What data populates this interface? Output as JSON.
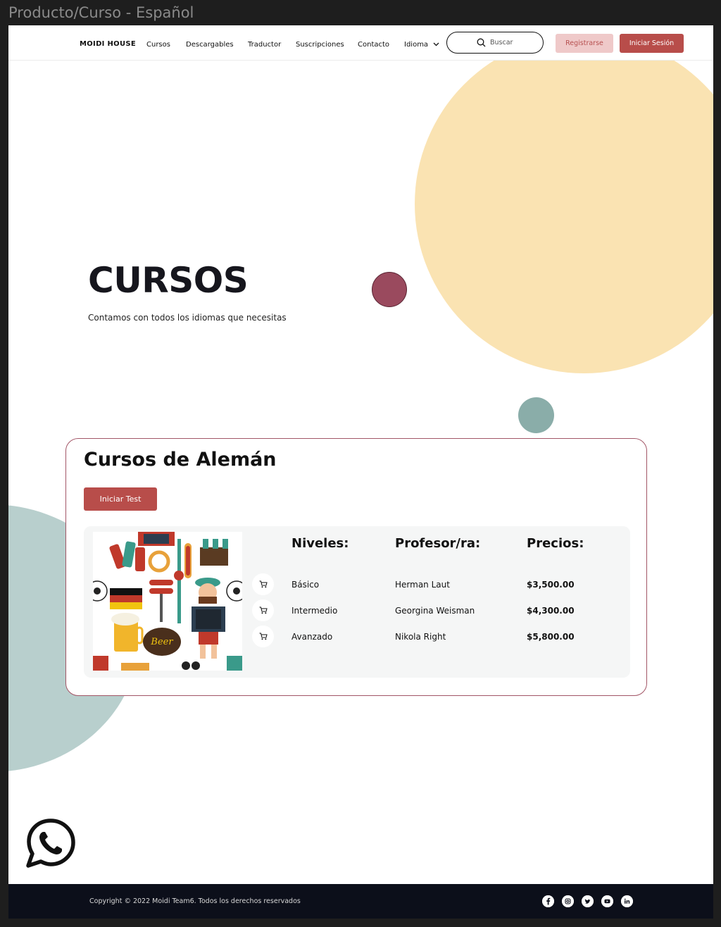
{
  "frame": {
    "title": "Producto/Curso - Español"
  },
  "navbar": {
    "brand": "MOIDI HOUSE",
    "links": [
      "Cursos",
      "Descargables",
      "Traductor",
      "Suscripciones",
      "Contacto",
      "Idioma"
    ],
    "search_placeholder": "Buscar",
    "register_label": "Registrarse",
    "login_label": "Iniciar Sesión"
  },
  "hero": {
    "title": "CURSOS",
    "subtitle": "Contamos con todos los idiomas que necesitas"
  },
  "course": {
    "title": "Cursos de Alemán",
    "test_button": "Iniciar Test",
    "image_text": "Beer",
    "headers": {
      "levels": "Niveles:",
      "teacher": "Profesor/ra:",
      "prices": "Precios:"
    },
    "rows": [
      {
        "level": "Básico",
        "teacher": "Herman Laut",
        "price": "$3,500.00"
      },
      {
        "level": "Intermedio",
        "teacher": "Georgina Weisman",
        "price": "$4,300.00"
      },
      {
        "level": "Avanzado",
        "teacher": "Nikola Right",
        "price": "$5,800.00"
      }
    ]
  },
  "footer": {
    "copyright": "Copyright © 2022 Moidi Team6. Todos los derechos reservados",
    "social": [
      "facebook-icon",
      "instagram-icon",
      "twitter-icon",
      "youtube-icon",
      "linkedin-icon"
    ]
  },
  "colors": {
    "accent": "#b84d4a",
    "accent_light": "#efc9c9",
    "yellow": "#fae3b2",
    "maroon": "#9a4a5e",
    "teal": "#8aada9",
    "footer_bg": "#0c0f1a"
  }
}
